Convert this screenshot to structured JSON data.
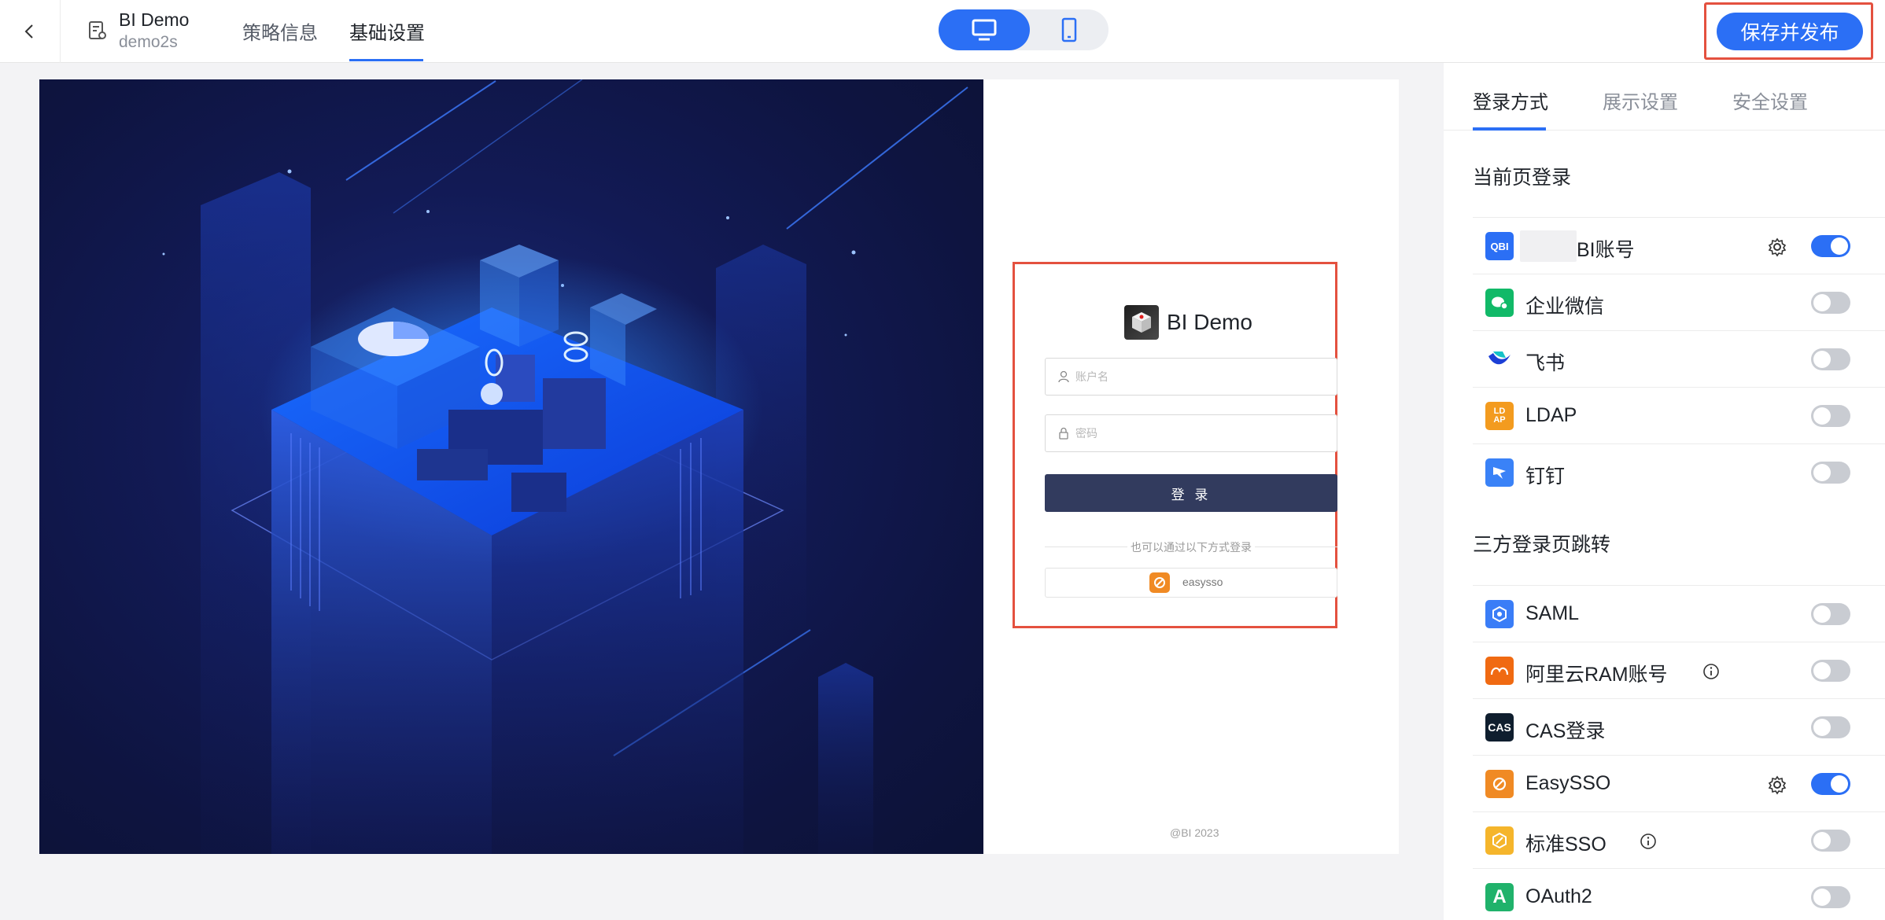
{
  "header": {
    "title": "BI Demo",
    "subtitle": "demo2s",
    "tabs": [
      "策略信息",
      "基础设置"
    ],
    "active_tab": "基础设置",
    "publish_label": "保存并发布"
  },
  "preview": {
    "brand_name": "BI Demo",
    "username_placeholder": "账户名",
    "password_placeholder": "密码",
    "login_button": "登 录",
    "alt_login_text": "也可以通过以下方式登录",
    "sso_button_label": "easysso",
    "copyright": "@BI 2023"
  },
  "panel": {
    "tabs": [
      "登录方式",
      "展示设置",
      "安全设置"
    ],
    "active_tab": "登录方式",
    "section_current": "当前页登录",
    "section_third_party": "三方登录页跳转",
    "current_methods": [
      {
        "label": "BI账号",
        "icon": "bi-account-icon",
        "icon_text": "QBI",
        "color": "#2b6ff5",
        "enabled": true,
        "has_settings": true
      },
      {
        "label": "企业微信",
        "icon": "wecom-icon",
        "color": "#11b968",
        "enabled": false
      },
      {
        "label": "飞书",
        "icon": "feishu-icon",
        "color": "#ffffff",
        "enabled": false
      },
      {
        "label": "LDAP",
        "icon": "ldap-icon",
        "icon_text": "LD AP",
        "color": "#f39b1f",
        "enabled": false
      },
      {
        "label": "钉钉",
        "icon": "dingtalk-icon",
        "color": "#3a82f7",
        "enabled": false
      }
    ],
    "third_party_methods": [
      {
        "label": "SAML",
        "icon": "saml-icon",
        "color": "#3a7df7",
        "enabled": false
      },
      {
        "label": "阿里云RAM账号",
        "icon": "aliyun-ram-icon",
        "color": "#f06a12",
        "enabled": false,
        "has_info": true
      },
      {
        "label": "CAS登录",
        "icon": "cas-icon",
        "icon_text": "CAS",
        "color": "#0f1e2e",
        "enabled": false
      },
      {
        "label": "EasySSO",
        "icon": "easysso-icon",
        "color": "#f08a24",
        "enabled": true,
        "has_settings": true
      },
      {
        "label": "标准SSO",
        "icon": "standard-sso-icon",
        "color": "#f5b52b",
        "enabled": false,
        "has_info": true
      },
      {
        "label": "OAuth2",
        "icon": "oauth2-icon",
        "icon_text": "A",
        "color": "#20b26b",
        "enabled": false
      }
    ]
  },
  "colors": {
    "accent": "#2b6ff5",
    "highlight_border": "#e4513f",
    "login_button": "#323b5e"
  }
}
